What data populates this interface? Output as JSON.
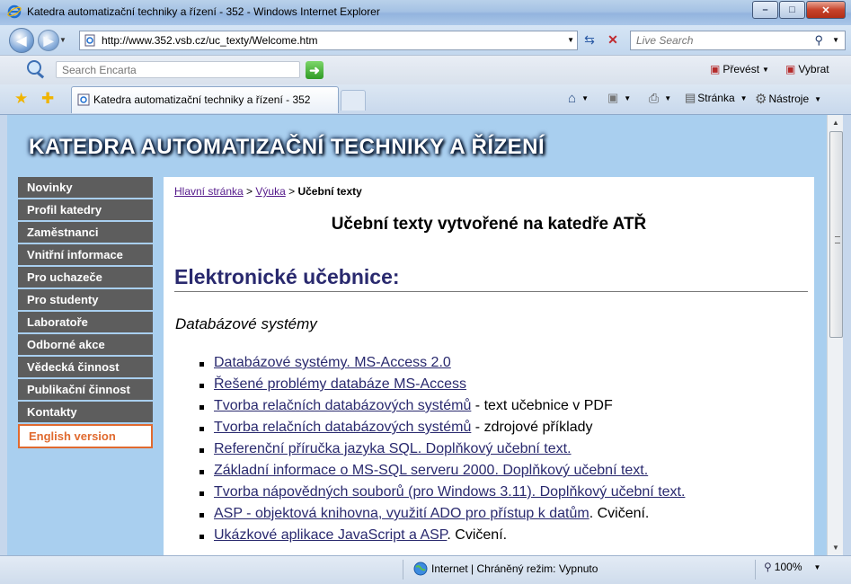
{
  "window": {
    "title": "Katedra automatizační techniky a řízení - 352 - Windows Internet Explorer",
    "minimize": "–",
    "maximize": "□",
    "close": "✕"
  },
  "address_bar": {
    "url": "http://www.352.vsb.cz/uc_texty/Welcome.htm",
    "search_placeholder": "Live Search"
  },
  "encarta_toolbar": {
    "search_placeholder": "Search Encarta",
    "prevest_label": "Převést",
    "vybrat_label": "Vybrat"
  },
  "tabs": [
    {
      "label": "Katedra automatizační techniky a řízení - 352"
    }
  ],
  "command_bar": {
    "stranka_label": "Stránka",
    "nastroje_label": "Nástroje"
  },
  "page": {
    "site_title": "KATEDRA AUTOMATIZAČNÍ TECHNIKY A ŘÍZENÍ",
    "sidebar": [
      {
        "label": "Novinky"
      },
      {
        "label": "Profil katedry"
      },
      {
        "label": "Zaměstnanci"
      },
      {
        "label": "Vnitřní informace"
      },
      {
        "label": "Pro uchazeče"
      },
      {
        "label": "Pro studenty"
      },
      {
        "label": "Laboratoře"
      },
      {
        "label": "Odborné akce"
      },
      {
        "label": "Vědecká činnost"
      },
      {
        "label": "Publikační činnost"
      },
      {
        "label": "Kontakty"
      },
      {
        "label": "English version"
      }
    ],
    "breadcrumb": {
      "home": "Hlavní stránka",
      "sep": ">",
      "vyuka": "Výuka",
      "current": "Učební texty"
    },
    "heading": "Učební texty vytvořené na katedře ATŘ",
    "section": "Elektronické učebnice:",
    "subsection": "Databázové systémy",
    "links": [
      {
        "link": "Databázové systémy. MS-Access 2.0",
        "suffix": ""
      },
      {
        "link": "Řešené problémy databáze MS-Access",
        "suffix": ""
      },
      {
        "link": "Tvorba relačních databázových systémů",
        "suffix": " - text učebnice v PDF"
      },
      {
        "link": "Tvorba relačních databázových systémů",
        "suffix": " - zdrojové příklady"
      },
      {
        "link": "Referenční příručka jazyka SQL. Doplňkový učební text.",
        "suffix": ""
      },
      {
        "link": "Základní informace o MS-SQL serveru 2000. Doplňkový učební text.",
        "suffix": ""
      },
      {
        "link": "Tvorba nápovědných souborů (pro Windows 3.11). Doplňkový učební text.",
        "suffix": ""
      },
      {
        "link": "ASP - objektová knihovna, využití ADO pro přístup k datům",
        "suffix": ". Cvičení."
      },
      {
        "link": "Ukázkové aplikace JavaScript a ASP",
        "suffix": ". Cvičení."
      }
    ]
  },
  "status_bar": {
    "zone": "Internet | Chráněný režim: Vypnuto",
    "zoom": "100%"
  }
}
